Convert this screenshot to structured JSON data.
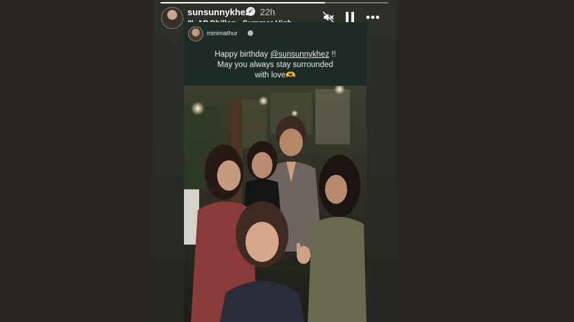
{
  "header": {
    "username": "sunsunnykhez",
    "time": "22h",
    "music_bars": "!!!",
    "music_artist": "AP Dhillon",
    "music_separator": "·",
    "music_song": "Summer High",
    "progress": 0.72
  },
  "controls": {
    "mute_icon": "speaker-muted-icon",
    "pause_icon": "pause-icon",
    "more_icon": "more-dots-icon"
  },
  "card": {
    "username": "minimathur",
    "caption_line1_prefix": "Happy birthday ",
    "caption_mention": "@sunsunnykhez",
    "caption_line1_suffix": " !!",
    "caption_line2": "May you always stay surrounded",
    "caption_line3": "with love",
    "caption_emoji": "🫶"
  },
  "colors": {
    "background": "#2b2621",
    "story_bg": "#2c2e2a",
    "text": "#ffffff"
  }
}
